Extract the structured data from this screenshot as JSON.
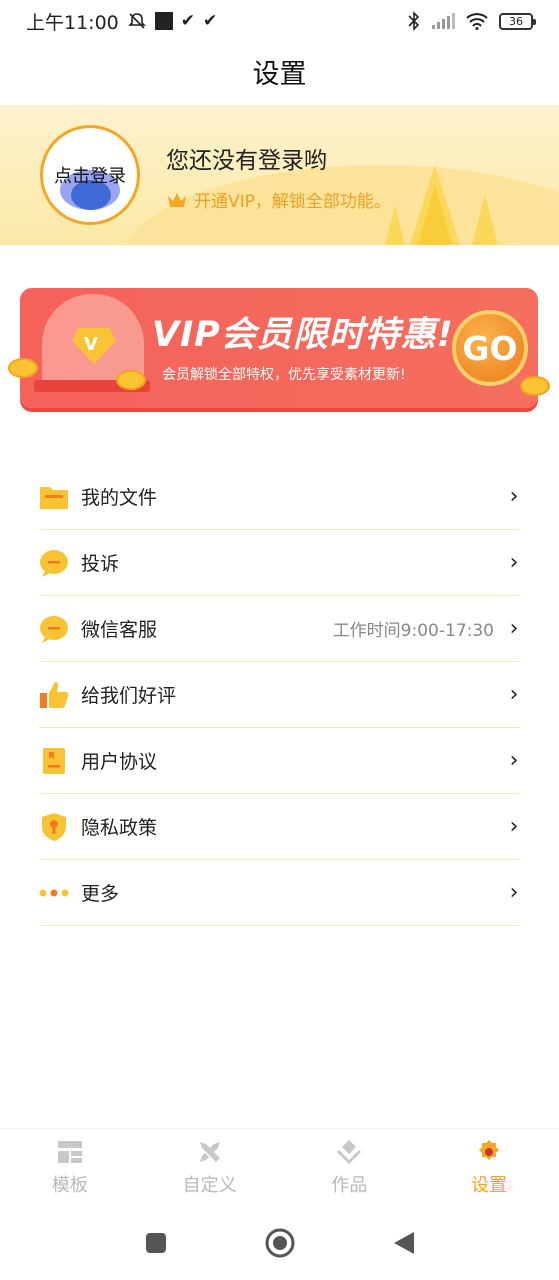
{
  "status_bar": {
    "time": "上午11:00",
    "battery": "36"
  },
  "page_title": "设置",
  "profile": {
    "avatar_text": "点击登录",
    "name": "您还没有登录哟",
    "vip_prompt": "开通VIP，解锁全部功能。"
  },
  "vip_banner": {
    "title": "VIP会员限时特惠!",
    "subtitle": "会员解锁全部特权，优先享受素材更新!",
    "gem_letter": "V",
    "go_label": "GO"
  },
  "menu": [
    {
      "label": "我的文件",
      "icon": "folder-icon",
      "extra": ""
    },
    {
      "label": "投诉",
      "icon": "chat-bubble-icon",
      "extra": ""
    },
    {
      "label": "微信客服",
      "icon": "chat-bubble-icon",
      "extra": "工作时间9:00-17:30"
    },
    {
      "label": "给我们好评",
      "icon": "thumbs-up-icon",
      "extra": ""
    },
    {
      "label": "用户协议",
      "icon": "document-icon",
      "extra": ""
    },
    {
      "label": "隐私政策",
      "icon": "shield-icon",
      "extra": ""
    },
    {
      "label": "更多",
      "icon": "more-dots-icon",
      "extra": ""
    }
  ],
  "bottom_nav": [
    {
      "label": "模板",
      "icon": "template-icon",
      "active": false
    },
    {
      "label": "自定义",
      "icon": "custom-tools-icon",
      "active": false
    },
    {
      "label": "作品",
      "icon": "works-icon",
      "active": false
    },
    {
      "label": "设置",
      "icon": "settings-gear-icon",
      "active": true
    }
  ],
  "colors": {
    "accent": "#f5a623",
    "banner_red": "#f4625a",
    "header_bg": "#fbe9a6"
  }
}
